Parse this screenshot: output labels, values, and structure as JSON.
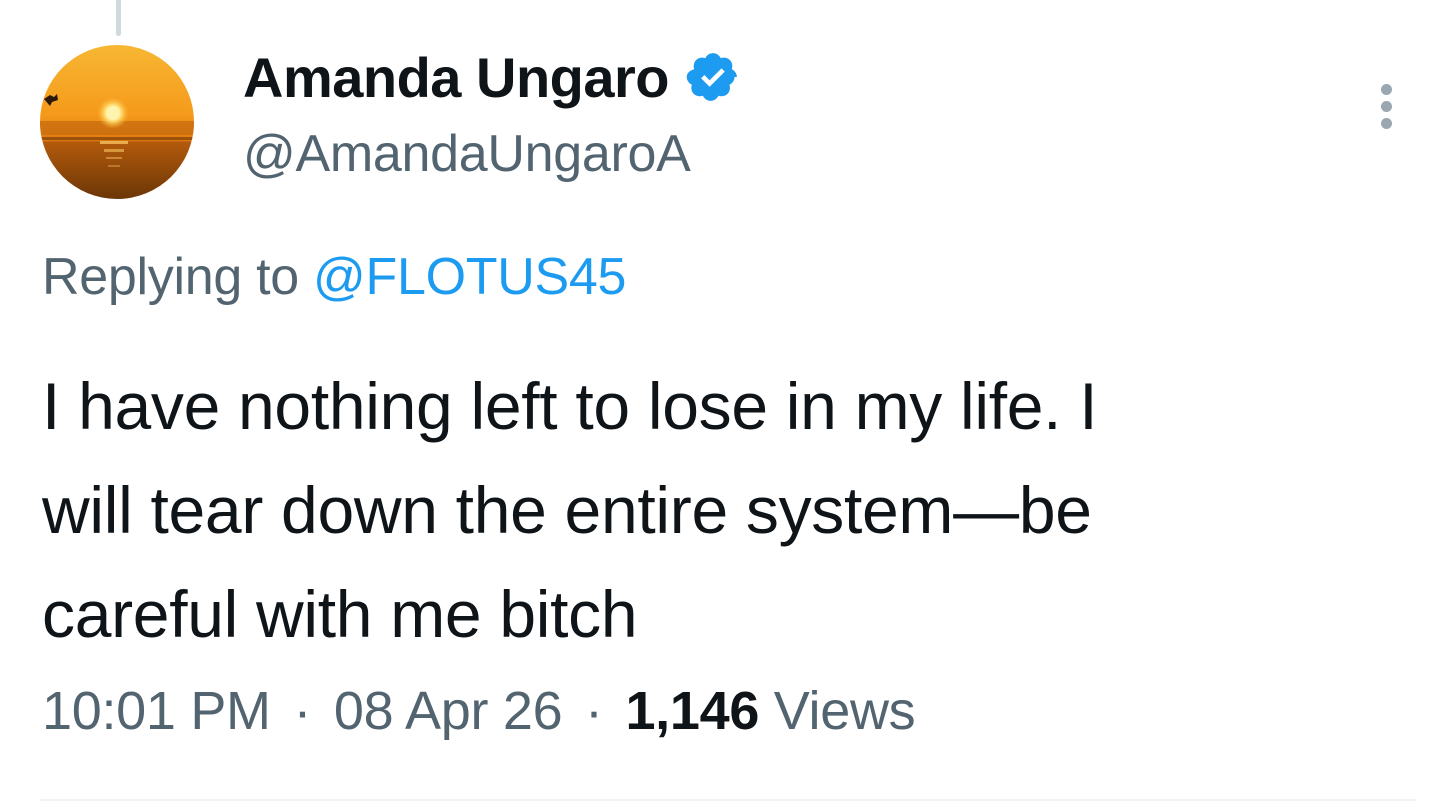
{
  "tweet": {
    "author": {
      "display_name": "Amanda Ungaro",
      "handle": "@AmandaUngaroA",
      "verified": true,
      "avatar": "sunset-photo"
    },
    "replying_to_label": "Replying to",
    "replying_to_handle": "@FLOTUS45",
    "text": "I have nothing left to lose in my life. I\nwill tear down the entire system—be\ncareful with me bitch",
    "time": "10:01 PM",
    "separator": "·",
    "date": "08 Apr 26",
    "views_count": "1,146",
    "views_label": "Views"
  },
  "icons": {
    "verified": "verified-badge-icon",
    "more": "more-options-icon"
  },
  "colors": {
    "text_primary": "#0f1419",
    "text_secondary": "#536471",
    "link": "#1d9bf0",
    "verified": "#1d9bf0"
  }
}
